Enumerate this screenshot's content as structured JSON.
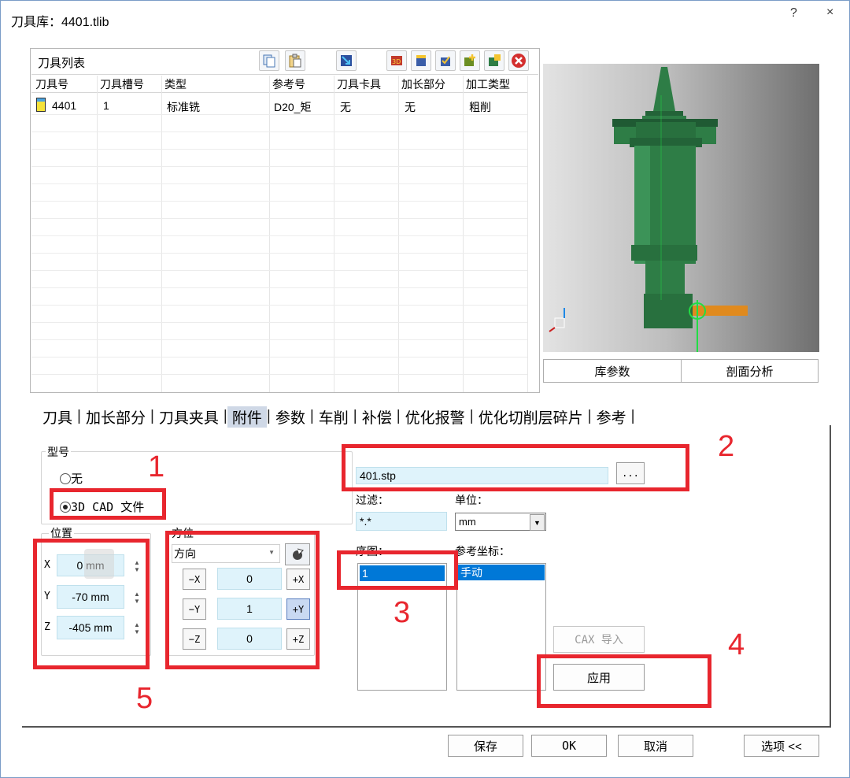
{
  "window": {
    "title": "刀具库：4401.tlib",
    "help": "?",
    "close": "×"
  },
  "tool_list": {
    "title": "刀具列表",
    "columns": [
      "刀具号",
      "刀具槽号",
      "类型",
      "参考号",
      "刀具卡具",
      "加长部分",
      "加工类型"
    ],
    "rows": [
      {
        "number": "4401",
        "slot": "1",
        "type": "标准铣",
        "ref": "D20_矩",
        "holder": "无",
        "extension": "无",
        "machining": "粗削"
      }
    ]
  },
  "preview_buttons": {
    "lib_params": "库参数",
    "section_analysis": "剖面分析"
  },
  "tabs": [
    "刀具",
    "加长部分",
    "刀具夹具",
    "附件",
    "参数",
    "车削",
    "补偿",
    "优化报警",
    "优化切削层碎片",
    "参考"
  ],
  "active_tab": "附件",
  "model_group": {
    "label": "型号",
    "opt_none": "无",
    "opt_cad": "3D CAD 文件"
  },
  "file": {
    "value": "401.stp",
    "browse": "...",
    "filter_label": "过滤：",
    "filter_value": "*.*",
    "unit_label": "单位：",
    "unit_value": "mm"
  },
  "position": {
    "label": "位置",
    "x_label": "X",
    "x_value": "0 mm",
    "y_label": "Y",
    "y_value": "-70 mm",
    "z_label": "Z",
    "z_value": "-405 mm"
  },
  "orientation": {
    "label": "方位",
    "mode": "方向",
    "minus_x": "−X",
    "x_value": "0",
    "plus_x": "+X",
    "minus_y": "−Y",
    "y_value": "1",
    "plus_y": "+Y",
    "minus_z": "−Z",
    "z_value": "0",
    "plus_z": "+Z"
  },
  "sequence": {
    "label": "序图：",
    "items": [
      "1"
    ]
  },
  "ref_coord": {
    "label": "参考坐标：",
    "items": [
      "手动"
    ]
  },
  "buttons": {
    "cax_import": "CAX 导入",
    "apply": "应用",
    "save": "保存",
    "ok": "OK",
    "cancel": "取消",
    "options": "选项 <<"
  },
  "annotations": [
    "1",
    "2",
    "3",
    "4",
    "5"
  ],
  "colors": {
    "highlight": "#e8262e",
    "selection": "#0078d7",
    "field": "#dff3fb",
    "tool_green": "#2e7d46",
    "axis_orange": "#e08a1e"
  }
}
